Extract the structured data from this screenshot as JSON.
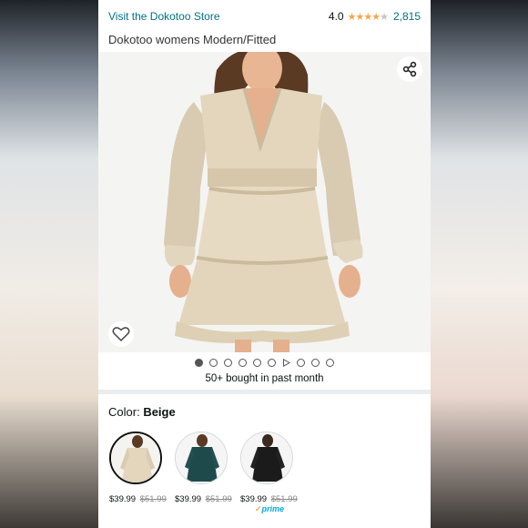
{
  "header": {
    "store_link": "Visit the Dokotoo Store",
    "rating_value": "4.0",
    "stars_filled": 4,
    "stars_total": 5,
    "rating_count": "2,815"
  },
  "product": {
    "title": "Dokotoo womens Modern/Fitted"
  },
  "gallery": {
    "image_count": 10,
    "active_index": 0,
    "video_index": 6
  },
  "social_proof": "50+ bought in past month",
  "color": {
    "label": "Color:",
    "selected": "Beige"
  },
  "variants": [
    {
      "name": "Beige",
      "price": "$39.99",
      "list_price": "$51.99",
      "prime": false,
      "selected": true,
      "dress_color": "#e3d6bd"
    },
    {
      "name": "Teal",
      "price": "$39.99",
      "list_price": "$51.99",
      "prime": false,
      "selected": false,
      "dress_color": "#1f4a4c"
    },
    {
      "name": "Black",
      "price": "$39.99",
      "list_price": "$51.99",
      "prime": true,
      "selected": false,
      "dress_color": "#1b1b1b"
    }
  ],
  "prime_label": "prime",
  "colors": {
    "link": "#007185",
    "star": "#f3a847",
    "prime": "#00a8e1"
  }
}
